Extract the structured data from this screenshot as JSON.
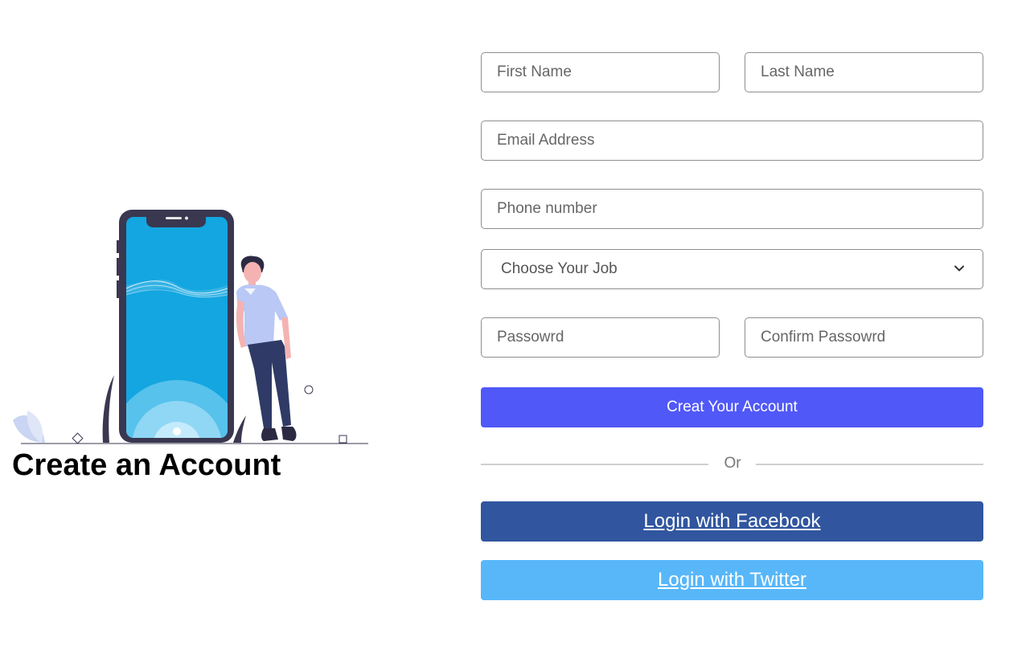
{
  "illustration": {
    "title": "Create an Account"
  },
  "form": {
    "first_name": {
      "placeholder": "First Name",
      "value": ""
    },
    "last_name": {
      "placeholder": "Last Name",
      "value": ""
    },
    "email": {
      "placeholder": "Email Address",
      "value": ""
    },
    "phone": {
      "placeholder": "Phone number",
      "value": ""
    },
    "job": {
      "selected": "Choose Your Job"
    },
    "password": {
      "placeholder": "Passowrd",
      "value": ""
    },
    "confirm_password": {
      "placeholder": "Confirm Passowrd",
      "value": ""
    },
    "submit_label": "Creat Your Account",
    "divider_label": "Or",
    "facebook_label": "Login with Facebook",
    "twitter_label": "Login with Twitter"
  },
  "colors": {
    "primary": "#5058f8",
    "facebook": "#31569f",
    "twitter": "#58b7f9",
    "phone_screen": "#13a6e0",
    "phone_frame": "#3a3751"
  },
  "icons": {
    "select_indicator": "chevron-down-icon"
  }
}
